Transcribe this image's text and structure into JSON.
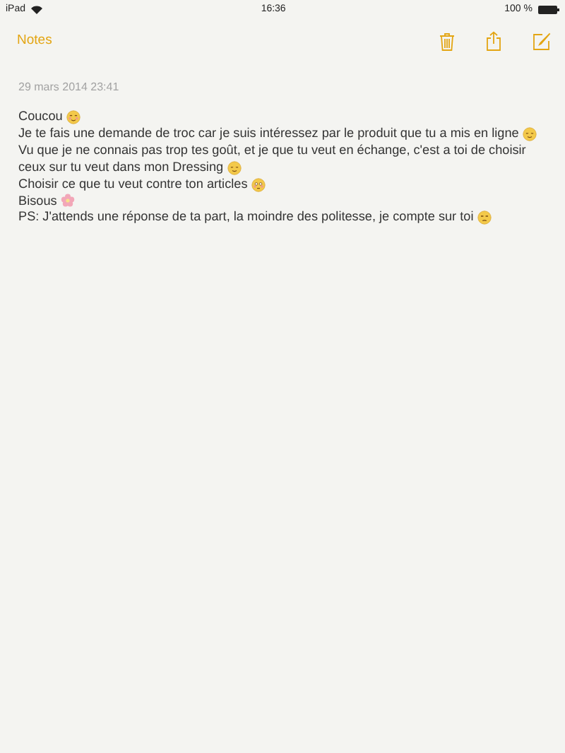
{
  "status_bar": {
    "device": "iPad",
    "time": "16:36",
    "battery": "100 %"
  },
  "nav": {
    "back": "Notes"
  },
  "note": {
    "date": "29 mars 2014 23:41",
    "lines": [
      {
        "text": "Coucou",
        "kind": "blush"
      },
      {
        "text": "Je te fais une demande de troc car je suis intéressez par le produit que tu a mis en ligne",
        "kind": "relieved"
      },
      {
        "text": "Vu que je ne connais pas trop tes goût, et je que tu veut en échange, c'est a toi de choisir",
        "kind": "plain"
      },
      {
        "text": "ceux sur tu veut dans mon Dressing",
        "kind": "relieved"
      },
      {
        "text": "Choisir ce que tu veut contre ton articles",
        "kind": "flushed"
      },
      {
        "text": "Bisous",
        "kind": "flower"
      },
      {
        "text": "PS: J'attends une réponse de ta part, la moindre des politesse, je compte sur toi",
        "kind": "unamused"
      }
    ]
  }
}
